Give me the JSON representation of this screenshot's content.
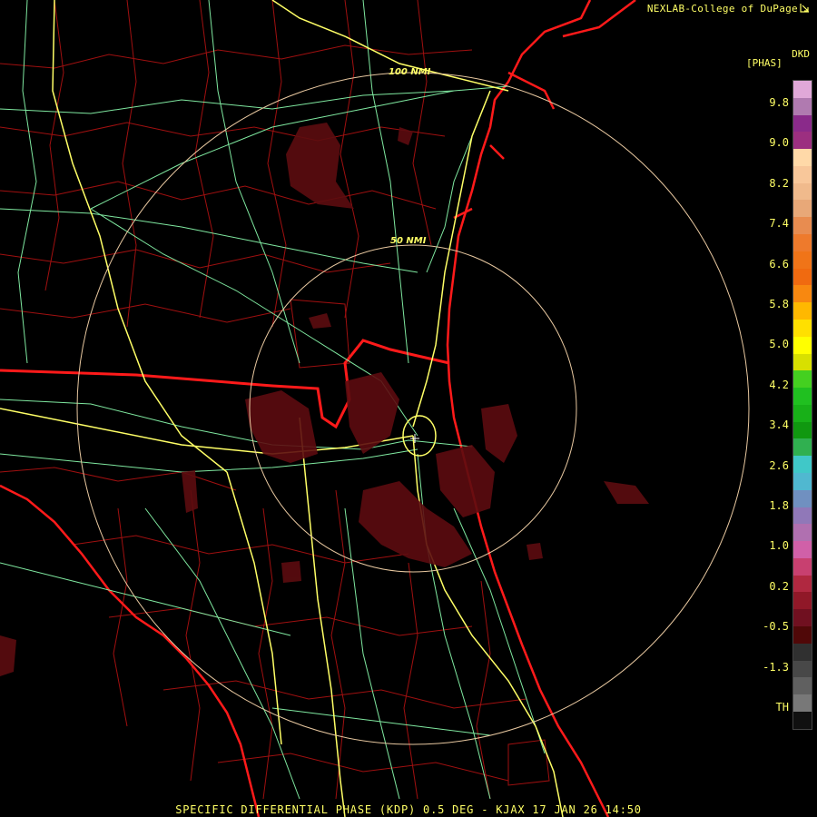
{
  "header": {
    "credit": "NEXLAB-College of DuPage",
    "logo_icon": "cod-logo-icon"
  },
  "legend": {
    "product_code": "DKD",
    "unit": "[PHAS]",
    "ticks": [
      "9.8",
      "9.0",
      "8.2",
      "7.4",
      "6.6",
      "5.8",
      "5.0",
      "4.2",
      "3.4",
      "2.6",
      "1.8",
      "1.0",
      "0.2",
      "-0.5",
      "-1.3",
      "TH"
    ],
    "colors": [
      "#e0a8d8",
      "#b07ab0",
      "#8a2a8a",
      "#9c2f80",
      "#ffd9a8",
      "#f8c79a",
      "#f0ba8c",
      "#e8a878",
      "#e88c50",
      "#ee7a2c",
      "#f07418",
      "#f06a10",
      "#f88810",
      "#ffb800",
      "#ffe000",
      "#ffff00",
      "#d8e000",
      "#44d020",
      "#20c020",
      "#18b018",
      "#109810",
      "#30b050",
      "#40c8c8",
      "#50b8d0",
      "#7090c0",
      "#9078b8",
      "#b070b0",
      "#d060a8",
      "#c84070",
      "#b02840",
      "#901828",
      "#701020",
      "#500808",
      "#303030",
      "#484848",
      "#606060",
      "#787878",
      "#101010"
    ]
  },
  "rings": {
    "inner_label": "50 NMI",
    "outer_label": "100 NMI"
  },
  "colors": {
    "coast": "#ff1a1a",
    "county": "#a01010",
    "highway": "#ffff66",
    "road": "#7fe8a0",
    "ring": "#e8c8a0",
    "echo": "#5c0c10"
  },
  "footer": {
    "caption": "SPECIFIC DIFFERENTIAL PHASE (KDP) 0.5 DEG - KJAX 17 JAN 26 14:50"
  }
}
